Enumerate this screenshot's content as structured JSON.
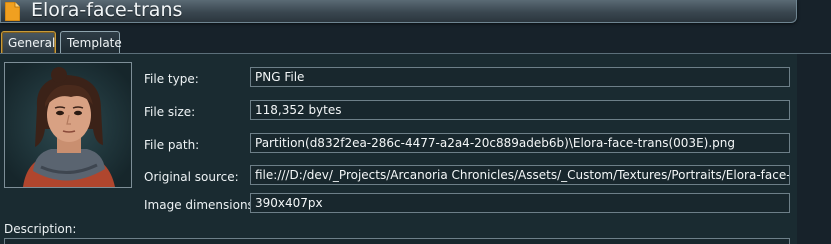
{
  "header": {
    "title": "Elora-face-trans",
    "icon": "file-icon",
    "icon_color": "#f0a020"
  },
  "tabs": [
    {
      "label": "General",
      "active": true
    },
    {
      "label": "Template",
      "active": false
    }
  ],
  "properties": {
    "file_type": {
      "label": "File type:",
      "value": "PNG File"
    },
    "file_size": {
      "label": "File size:",
      "value": "118,352 bytes"
    },
    "file_path": {
      "label": "File path:",
      "value": "Partition(d832f2ea-286c-4477-a2a4-20c889adeb6b)\\Elora-face-trans(003E).png"
    },
    "original_source": {
      "label": "Original source:",
      "value": "file:///D:/dev/_Projects/Arcanoria Chronicles/Assets/_Custom/Textures/Portraits/Elora-face-trans.png"
    },
    "image_dimensions": {
      "label": "Image dimensions:",
      "value": "390x407px"
    }
  },
  "description": {
    "label": "Description:",
    "value": ""
  },
  "preview": {
    "icon": "portrait-thumbnail"
  },
  "colors": {
    "accent_tab_border": "#c89a38",
    "background": "#17222a"
  }
}
